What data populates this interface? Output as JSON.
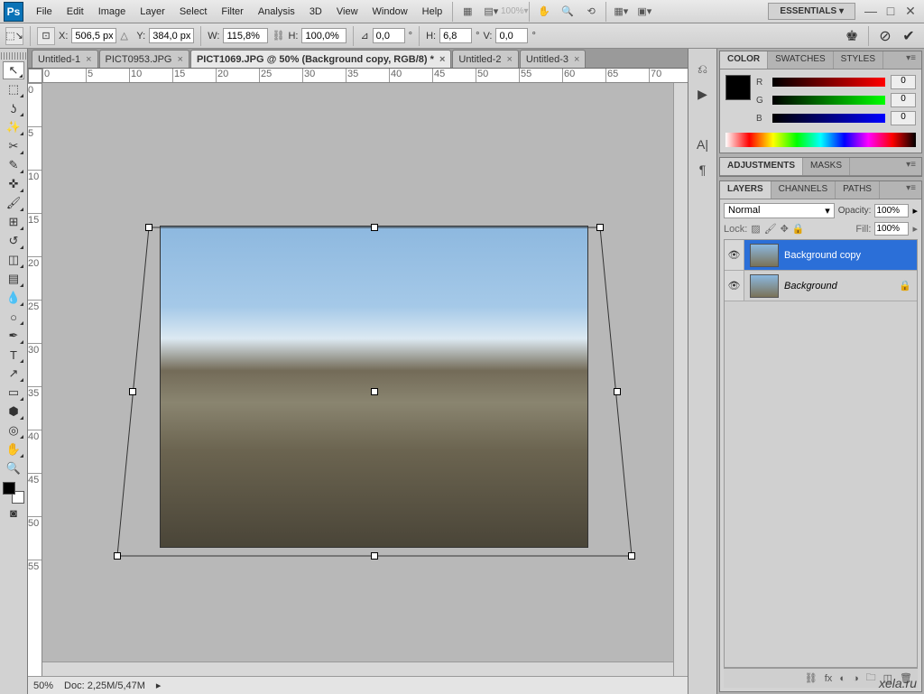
{
  "menu": {
    "items": [
      "File",
      "Edit",
      "Image",
      "Layer",
      "Select",
      "Filter",
      "Analysis",
      "3D",
      "View",
      "Window",
      "Help"
    ]
  },
  "workspace": "ESSENTIALS ▾",
  "options": {
    "x_label": "X:",
    "x": "506,5 px",
    "y_label": "Y:",
    "y": "384,0 px",
    "w_label": "W:",
    "w": "115,8%",
    "h_label": "H:",
    "h": "100,0%",
    "angle_label": "⊿",
    "angle": "0,0",
    "angle_unit": "°",
    "hskew_label": "H:",
    "hskew": "6,8",
    "vskew_label": "V:",
    "vskew": "0,0"
  },
  "tabs": [
    {
      "label": "Untitled-1",
      "active": false
    },
    {
      "label": "PICT0953.JPG",
      "active": false
    },
    {
      "label": "PICT1069.JPG @ 50% (Background copy, RGB/8) *",
      "active": true
    },
    {
      "label": "Untitled-2",
      "active": false
    },
    {
      "label": "Untitled-3",
      "active": false
    }
  ],
  "status": {
    "zoom": "50%",
    "doc": "Doc: 2,25M/5,47M"
  },
  "color_panel": {
    "tabs": [
      "COLOR",
      "SWATCHES",
      "STYLES"
    ],
    "r_label": "R",
    "r": "0",
    "g_label": "G",
    "g": "0",
    "b_label": "B",
    "b": "0"
  },
  "adjustments_panel": {
    "tabs": [
      "ADJUSTMENTS",
      "MASKS"
    ]
  },
  "layers_panel": {
    "tabs": [
      "LAYERS",
      "CHANNELS",
      "PATHS"
    ],
    "blend_mode": "Normal",
    "opacity_label": "Opacity:",
    "opacity": "100%",
    "lock_label": "Lock:",
    "fill_label": "Fill:",
    "fill": "100%",
    "layers": [
      {
        "name": "Background copy",
        "active": true,
        "locked": false
      },
      {
        "name": "Background",
        "active": false,
        "locked": true
      }
    ]
  },
  "ruler_h": [
    "0",
    "5",
    "10",
    "15",
    "20",
    "25",
    "30",
    "35",
    "40",
    "45",
    "50",
    "55",
    "60",
    "65",
    "70"
  ],
  "ruler_v": [
    "0",
    "5",
    "10",
    "15",
    "20",
    "25",
    "30",
    "35",
    "40",
    "45",
    "50",
    "55"
  ],
  "watermark": "xela.ru"
}
